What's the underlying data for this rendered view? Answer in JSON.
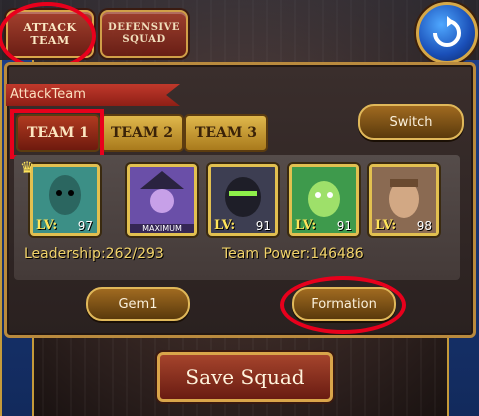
{
  "top_nav": {
    "attack_team": "ATTACK TEAM",
    "defensive_squad": "DEFENSIVE SQUAD"
  },
  "panel": {
    "label": "AttackTeam",
    "tabs": [
      "TEAM 1",
      "TEAM 2",
      "TEAM 3"
    ],
    "active_tab": 0,
    "switch": "Switch"
  },
  "heroes": [
    {
      "lv": "LV:",
      "level": "97",
      "leader": true,
      "color": "#3c8f86"
    },
    {
      "lv": "",
      "level": "",
      "badge": "MAXIMUM",
      "color": "#6a4fa8"
    },
    {
      "lv": "LV:",
      "level": "91",
      "color": "#3d3e52"
    },
    {
      "lv": "LV:",
      "level": "91",
      "color": "#3e9a4c"
    },
    {
      "lv": "LV:",
      "level": "98",
      "color": "#8a6a52"
    }
  ],
  "stats": {
    "leadership": "Leadership:262/293",
    "team_power": "Team Power:146486"
  },
  "buttons": {
    "gem": "Gem1",
    "formation": "Formation",
    "save": "Save Squad"
  },
  "colors": {
    "highlight": "#e8001c",
    "gold": "#f2d36a"
  }
}
